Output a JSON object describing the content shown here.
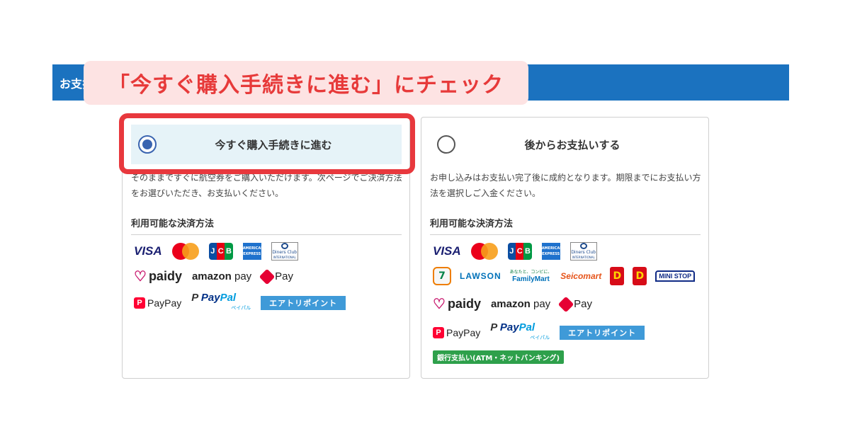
{
  "header": {
    "title": "お支払い方法"
  },
  "callout": {
    "text": "「今すぐ購入手続きに進む」にチェック"
  },
  "options": [
    {
      "label": "今すぐ購入手続きに進む",
      "checked": true,
      "description": "そのままですぐに航空券をご購入いただけます。次ページでご決済方法をお選びいただき、お支払いください。",
      "methods_title": "利用可能な決済方法",
      "logo_rows": [
        [
          "visa-logo",
          "mastercard-logo",
          "jcb-logo",
          "amex-logo",
          "diners-club-logo"
        ],
        [
          "paidy-logo",
          "amazon-pay-logo",
          "d-pay-logo"
        ],
        [
          "paypay-logo",
          "paypal-logo",
          "aeri-point-logo"
        ]
      ]
    },
    {
      "label": "後からお支払いする",
      "checked": false,
      "description": "お申し込みはお支払い完了後に成約となります。期限までにお支払い方法を選択しご入金ください。",
      "methods_title": "利用可能な決済方法",
      "logo_rows": [
        [
          "visa-logo",
          "mastercard-logo",
          "jcb-logo",
          "amex-logo",
          "diners-club-logo"
        ],
        [
          "seven-eleven-logo",
          "lawson-logo",
          "familymart-logo",
          "seicomart-logo",
          "daily-yamazaki-logo",
          "new-daily-logo",
          "ministop-logo"
        ],
        [
          "paidy-logo",
          "amazon-pay-logo",
          "d-pay-logo"
        ],
        [
          "paypay-logo",
          "paypal-logo",
          "aeri-point-logo"
        ],
        [
          "bank-transfer-logo"
        ]
      ]
    }
  ],
  "brands": {
    "visa": "VISA",
    "jcb": [
      "J",
      "C",
      "B"
    ],
    "amex": "AMERICAN EXPRESS",
    "diners": "Diners Club",
    "diners_sub": "INTERNATIONAL",
    "paidy": "paidy",
    "amazon_a": "amazon",
    "amazon_b": " pay",
    "dpay": "Pay",
    "paypay": "PayPay",
    "paypal_a": "Pay",
    "paypal_b": "Pal",
    "paypal_kana": "ペイパル",
    "aeri": "エアトリポイント",
    "seven": "7",
    "lawson": "LAWSON",
    "fm_small": "あなたと、コンビに、",
    "fm_big": "FamilyMart",
    "seico": "Seicomart",
    "daily": "D",
    "ministop": "MINI STOP",
    "bank": "銀行支払い(ATM・ネットバンキング)"
  },
  "colors": {
    "header": "#1b72bf",
    "callout_bg": "#fde3e3",
    "callout_text": "#e73a3a",
    "highlight": "#e8383d",
    "selected_bg": "#e6f3f8",
    "radio": "#3a64b0"
  }
}
